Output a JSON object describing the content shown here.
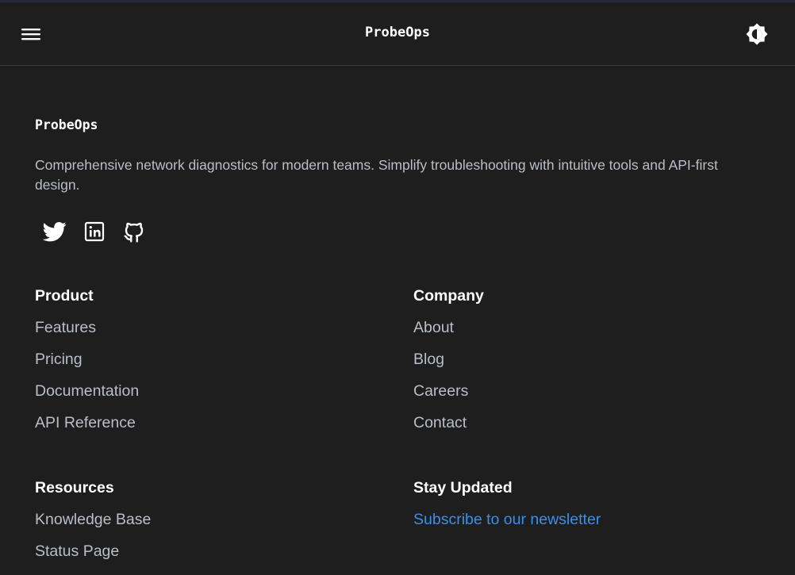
{
  "header": {
    "title": "ProbeOps",
    "menu_icon": "hamburger-menu-icon",
    "theme_icon": "brightness-toggle-icon"
  },
  "footer": {
    "brand": "ProbeOps",
    "tagline": "Comprehensive network diagnostics for modern teams. Simplify troubleshooting with intuitive tools and API-first design.",
    "social": [
      {
        "icon": "twitter-icon"
      },
      {
        "icon": "linkedin-icon"
      },
      {
        "icon": "github-icon"
      }
    ],
    "product": {
      "heading": "Product",
      "links": [
        "Features",
        "Pricing",
        "Documentation",
        "API Reference"
      ]
    },
    "company": {
      "heading": "Company",
      "links": [
        "About",
        "Blog",
        "Careers",
        "Contact"
      ]
    },
    "resources": {
      "heading": "Resources",
      "links": [
        "Knowledge Base",
        "Status Page"
      ]
    },
    "newsletter": {
      "heading": "Stay Updated",
      "link": "Subscribe to our newsletter"
    }
  },
  "colors": {
    "background": "#1e1e1e",
    "text_primary": "#ffffff",
    "text_secondary": "#b9bec8",
    "accent": "#3b8eea",
    "divider": "#3a3a3a"
  }
}
